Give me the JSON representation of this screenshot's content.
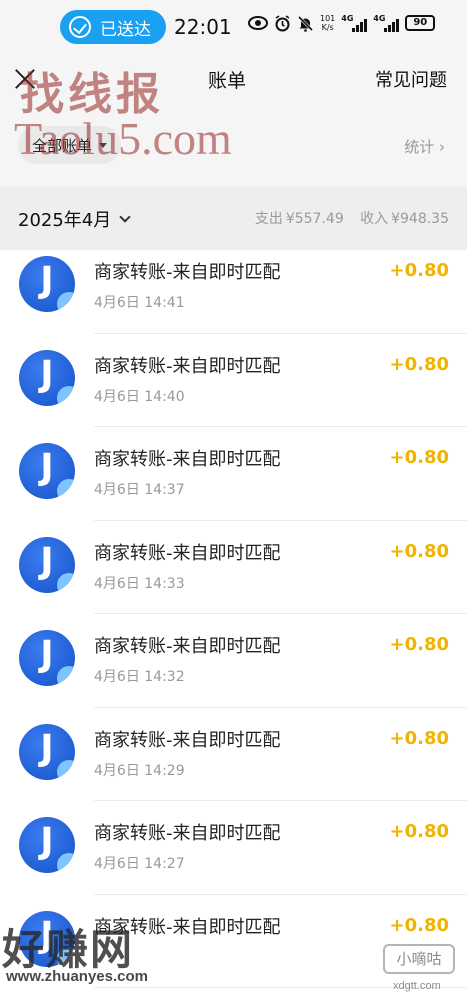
{
  "status_bar": {
    "sent_label": "已送达",
    "time": "22:01",
    "net_speed_value": "101",
    "net_speed_unit": "K/s",
    "signal_1": "4G",
    "signal_2": "4G",
    "battery": "90"
  },
  "header": {
    "title": "账单",
    "faq_label": "常见问题"
  },
  "filter": {
    "all_bills_label": "全部账单",
    "stats_label": "统计"
  },
  "month": {
    "label": "2025年4月",
    "expense_label": "支出",
    "expense_value": "¥557.49",
    "income_label": "收入",
    "income_value": "¥948.35"
  },
  "transactions": [
    {
      "title": "商家转账-来自即时匹配",
      "time": "4月6日 14:41",
      "amount": "+0.80"
    },
    {
      "title": "商家转账-来自即时匹配",
      "time": "4月6日 14:40",
      "amount": "+0.80"
    },
    {
      "title": "商家转账-来自即时匹配",
      "time": "4月6日 14:37",
      "amount": "+0.80"
    },
    {
      "title": "商家转账-来自即时匹配",
      "time": "4月6日 14:33",
      "amount": "+0.80"
    },
    {
      "title": "商家转账-来自即时匹配",
      "time": "4月6日 14:32",
      "amount": "+0.80"
    },
    {
      "title": "商家转账-来自即时匹配",
      "time": "4月6日 14:29",
      "amount": "+0.80"
    },
    {
      "title": "商家转账-来自即时匹配",
      "time": "4月6日 14:27",
      "amount": "+0.80"
    },
    {
      "title": "商家转账-来自即时匹配",
      "time": "",
      "amount": "+0.80"
    }
  ],
  "avatar_letter": "J",
  "watermarks": {
    "top_cn": "找线报",
    "top_en": "Taolu5.com",
    "bottom_left_cn": "好赚网",
    "bottom_left_url": "www.zhuanyes.com",
    "bottom_right_badge": "小嘀咕",
    "bottom_right_url": "xdgtt.com"
  },
  "colors": {
    "sent_pill": "#1aa0f0",
    "amount": "#f0b400",
    "avatar": "#1f5fd6",
    "header_bg": "#f5f5f5"
  },
  "icons": {
    "close": "close-icon",
    "stats_chevron": "chevron-right-icon",
    "month_chevron": "chevron-down-icon",
    "filter_caret": "caret-down-icon"
  }
}
